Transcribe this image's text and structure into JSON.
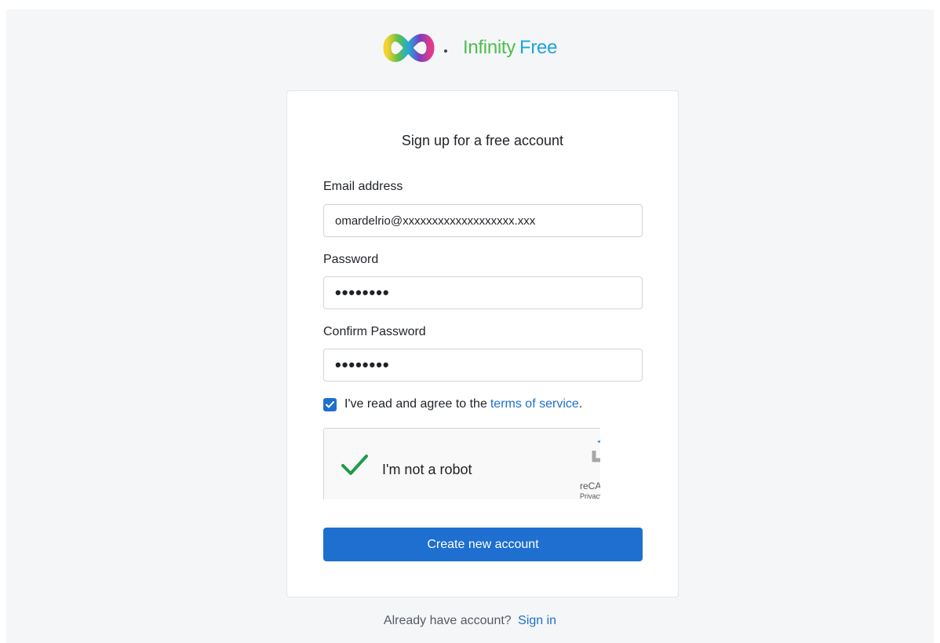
{
  "brand": {
    "logo_word1": "Infinity",
    "logo_word2": "Free",
    "colors": {
      "green": "#4cc04a",
      "blue": "#1aa7d9"
    }
  },
  "form": {
    "title": "Sign up for a free account",
    "email_label": "Email address",
    "email_value": "omardelrio@xxxxxxxxxxxxxxxxxxx.xxx",
    "password_label": "Password",
    "password_value": "••••••••",
    "confirm_label": "Confirm Password",
    "confirm_value": "••••••••",
    "agree_text": "I've read and agree to the",
    "agree_link": "terms of service",
    "agree_suffix": ".",
    "agree_checked": true,
    "recaptcha_label": "I'm not a robot",
    "recaptcha_brand": "reCAPTCHA",
    "recaptcha_privacy": "Privacy - Terms",
    "submit_label": "Create new account"
  },
  "footer": {
    "prompt": "Already have account?",
    "link": "Sign in"
  },
  "theme": {
    "accent": "#1e6fd0",
    "page_bg": "#f5f6f8",
    "check_green": "#1e9c4a"
  }
}
